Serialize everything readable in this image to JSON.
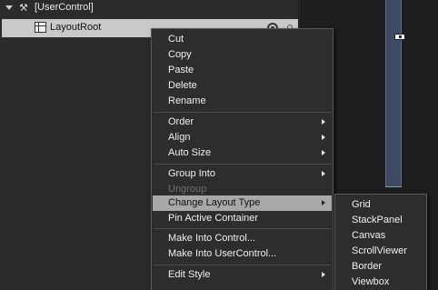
{
  "tree": {
    "root_label": "[UserControl]",
    "child_label": "LayoutRoot"
  },
  "context_menu": {
    "items": [
      {
        "label": "Cut",
        "has_submenu": false,
        "enabled": true
      },
      {
        "label": "Copy",
        "has_submenu": false,
        "enabled": true
      },
      {
        "label": "Paste",
        "has_submenu": false,
        "enabled": true
      },
      {
        "label": "Delete",
        "has_submenu": false,
        "enabled": true
      },
      {
        "label": "Rename",
        "has_submenu": false,
        "enabled": true
      },
      {
        "label": "Order",
        "has_submenu": true,
        "enabled": true
      },
      {
        "label": "Align",
        "has_submenu": true,
        "enabled": true
      },
      {
        "label": "Auto Size",
        "has_submenu": true,
        "enabled": true
      },
      {
        "label": "Group Into",
        "has_submenu": true,
        "enabled": true
      },
      {
        "label": "Ungroup",
        "has_submenu": false,
        "enabled": false
      },
      {
        "label": "Change Layout Type",
        "has_submenu": true,
        "enabled": true,
        "highlighted": true
      },
      {
        "label": "Pin Active Container",
        "has_submenu": false,
        "enabled": true
      },
      {
        "label": "Make Into Control...",
        "has_submenu": false,
        "enabled": true
      },
      {
        "label": "Make Into UserControl...",
        "has_submenu": false,
        "enabled": true
      },
      {
        "label": "Edit Style",
        "has_submenu": true,
        "enabled": true
      }
    ]
  },
  "layout_submenu": {
    "items": [
      "Grid",
      "StackPanel",
      "Canvas",
      "ScrollViewer",
      "Border",
      "Viewbox"
    ]
  },
  "colors": {
    "menu_background": "#2d2d2d",
    "menu_highlight": "#a8a8a8",
    "selected_row": "#c9c9c9",
    "artboard_frame": "#3d4a63"
  }
}
